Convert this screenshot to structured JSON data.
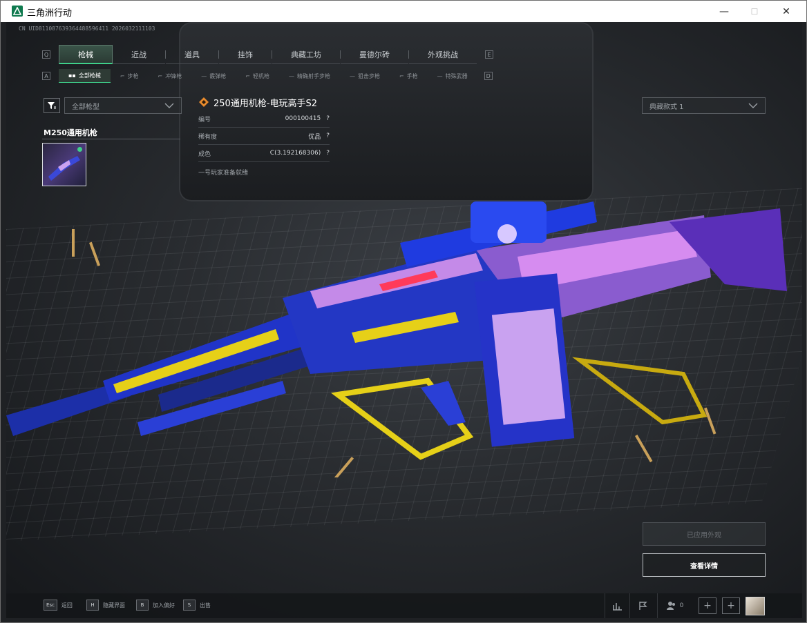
{
  "window": {
    "title": "三角洲行动",
    "min": "—",
    "max": "☐",
    "close": "✕"
  },
  "uid": "CN UID811087639364488596411 2026032111103",
  "tabs": [
    "枪械",
    "近战",
    "道具",
    "挂饰",
    "典藏工坊",
    "曼德尔砖",
    "外观挑战"
  ],
  "tab_keys": {
    "left": "Q",
    "right": "E"
  },
  "subtabs": [
    "全部枪械",
    "步枪",
    "冲锋枪",
    "霰弹枪",
    "轻机枪",
    "精确射手步枪",
    "狙击步枪",
    "手枪",
    "特殊武器"
  ],
  "subtab_keys": {
    "left": "A",
    "right": "D"
  },
  "filter": {
    "gun_type": "全部枪型",
    "style": "典藏款式 1"
  },
  "gun_type_title": "M250通用机枪",
  "skin": {
    "name": "250通用机枪-电玩高手S2",
    "rows": [
      {
        "label": "编号",
        "value": "000100415",
        "help": "?"
      },
      {
        "label": "稀有度",
        "value": "优品",
        "help": "?"
      },
      {
        "label": "成色",
        "value": "C(3.192168306)",
        "help": "?"
      }
    ],
    "note": "一号玩家准备就绪"
  },
  "buttons": {
    "applied": "已应用外观",
    "details": "查看详情"
  },
  "bottom": {
    "hints": [
      {
        "key": "Esc",
        "label": "返回"
      },
      {
        "key": "H",
        "label": "隐藏界面"
      },
      {
        "key": "B",
        "label": "加入偏好"
      },
      {
        "key": "S",
        "label": "出售"
      }
    ],
    "friends_count": "0"
  },
  "colors": {
    "accent": "#3fd08a",
    "brand": "#0f7a4f"
  }
}
